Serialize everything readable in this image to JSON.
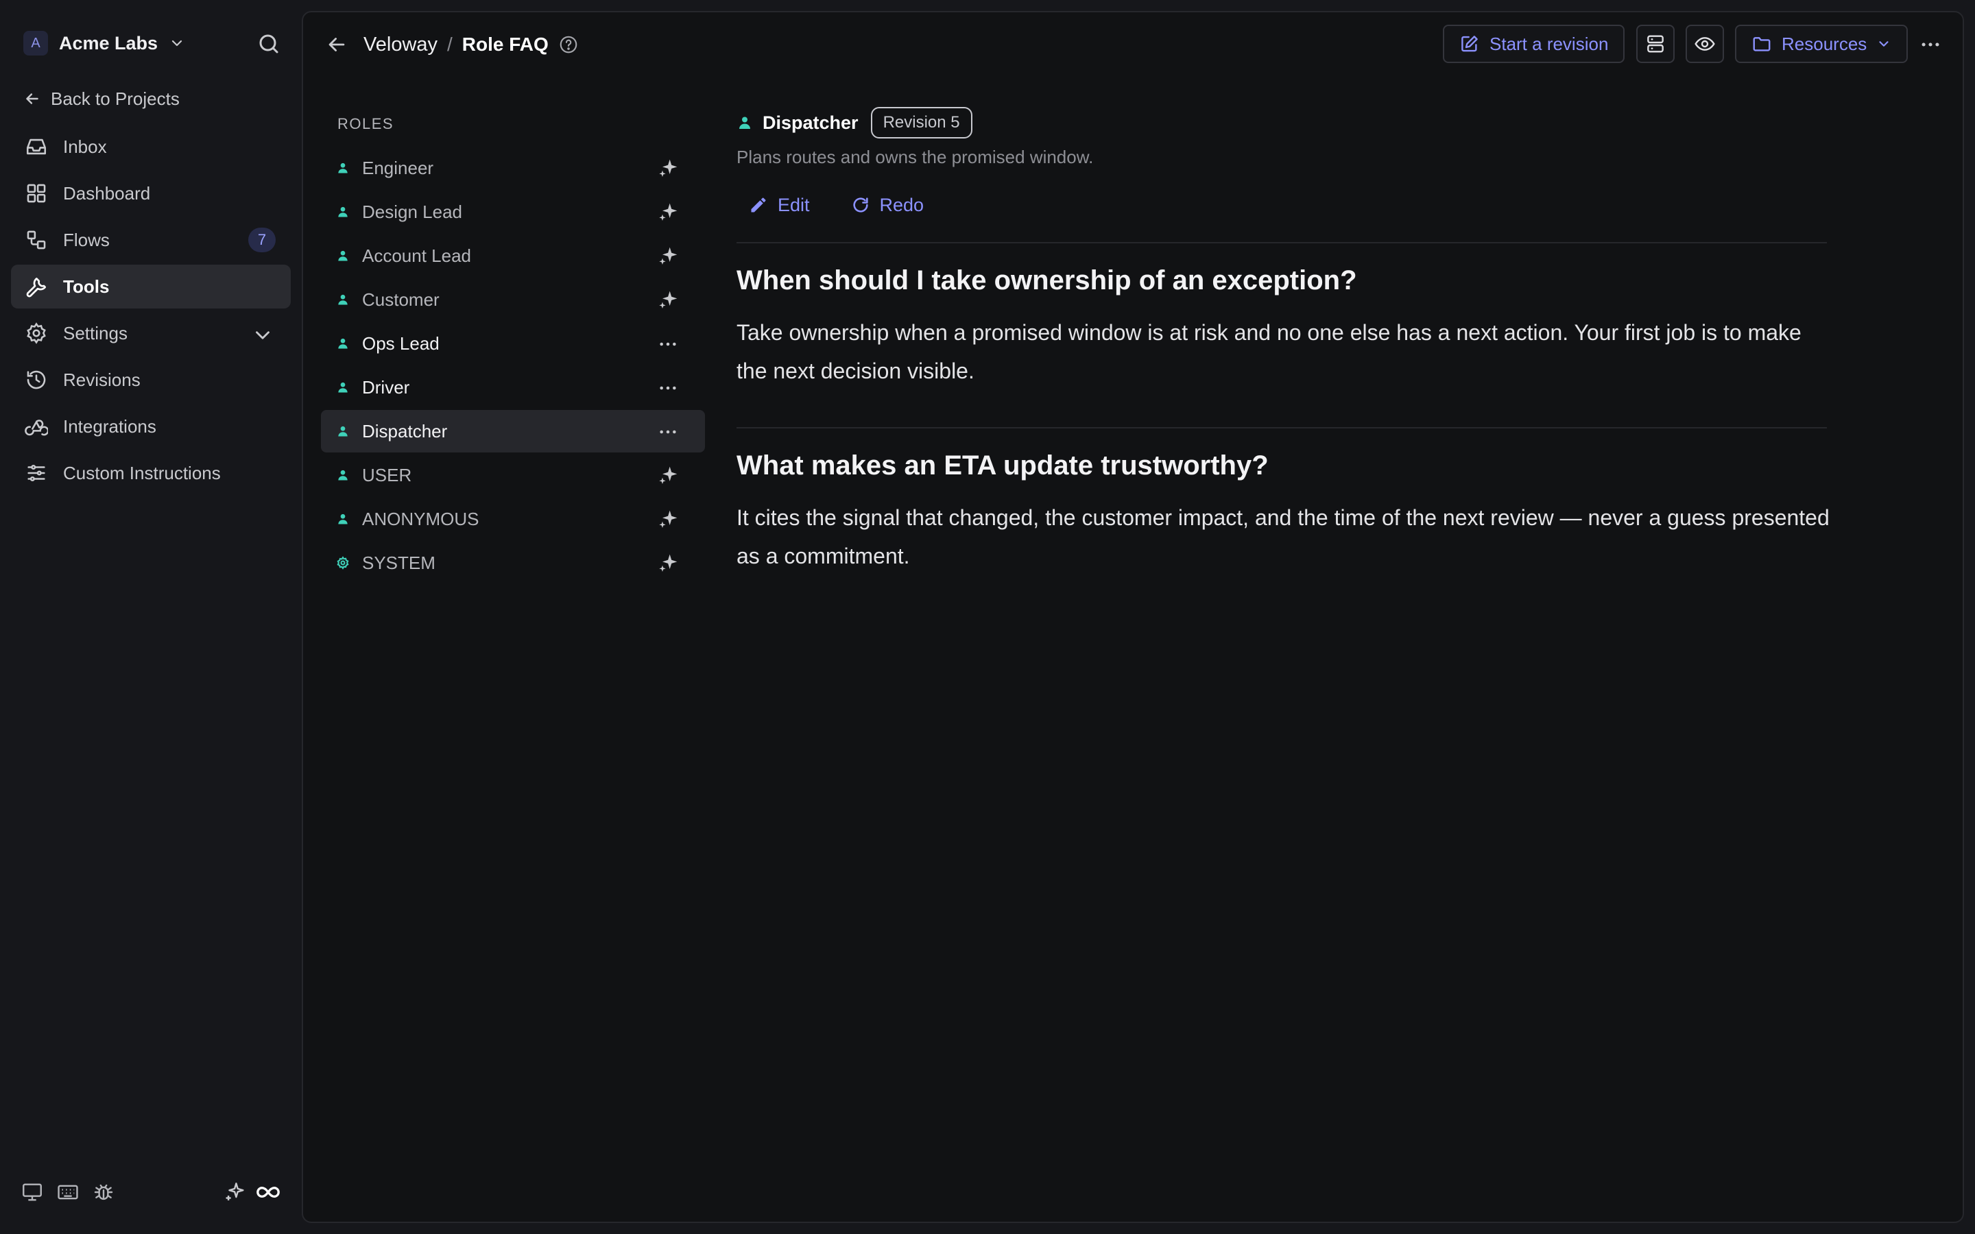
{
  "workspace": {
    "initial": "A",
    "name": "Acme Labs"
  },
  "sidebar": {
    "back_label": "Back to Projects",
    "items": [
      {
        "label": "Inbox",
        "icon": "inbox-icon"
      },
      {
        "label": "Dashboard",
        "icon": "dashboard-icon"
      },
      {
        "label": "Flows",
        "icon": "flows-icon",
        "badge": "7"
      },
      {
        "label": "Tools",
        "icon": "wrench-icon",
        "active": true
      },
      {
        "label": "Settings",
        "icon": "gear-icon"
      },
      {
        "label": "Revisions",
        "icon": "history-icon"
      },
      {
        "label": "Integrations",
        "icon": "webhook-icon"
      },
      {
        "label": "Custom Instructions",
        "icon": "sliders-icon"
      }
    ],
    "footer_icons": [
      "monitor-icon",
      "keyboard-icon",
      "bug-icon",
      "sparkle-icon",
      "infinity-icon"
    ]
  },
  "header": {
    "project": "Veloway",
    "separator": "/",
    "page": "Role FAQ",
    "start_revision_label": "Start a revision",
    "resources_label": "Resources"
  },
  "roles": {
    "title": "ROLES",
    "items": [
      {
        "label": "Engineer",
        "action": "sparkle"
      },
      {
        "label": "Design Lead",
        "action": "sparkle"
      },
      {
        "label": "Account Lead",
        "action": "sparkle"
      },
      {
        "label": "Customer",
        "action": "sparkle"
      },
      {
        "label": "Ops Lead",
        "action": "more",
        "strong": true
      },
      {
        "label": "Driver",
        "action": "more",
        "strong": true
      },
      {
        "label": "Dispatcher",
        "action": "more",
        "strong": true,
        "active": true
      },
      {
        "label": "USER",
        "action": "sparkle"
      },
      {
        "label": "ANONYMOUS",
        "action": "sparkle"
      },
      {
        "label": "SYSTEM",
        "action": "sparkle",
        "icon": "gear"
      }
    ]
  },
  "detail": {
    "role_name": "Dispatcher",
    "revision": "Revision 5",
    "description": "Plans routes and owns the promised window.",
    "edit_label": "Edit",
    "redo_label": "Redo",
    "faqs": [
      {
        "question": "When should I take ownership of an exception?",
        "answer": "Take ownership when a promised window is at risk and no one else has a next action. Your first job is to make the next decision visible."
      },
      {
        "question": "What makes an ETA update trustworthy?",
        "answer": "It cites the signal that changed, the customer impact, and the time of the next review — never a guess presented as a commitment."
      }
    ]
  },
  "colors": {
    "accent": "#8c92ff",
    "role_icon": "#3fd1b9",
    "background": "#111214",
    "sidebar": "#16171b"
  }
}
